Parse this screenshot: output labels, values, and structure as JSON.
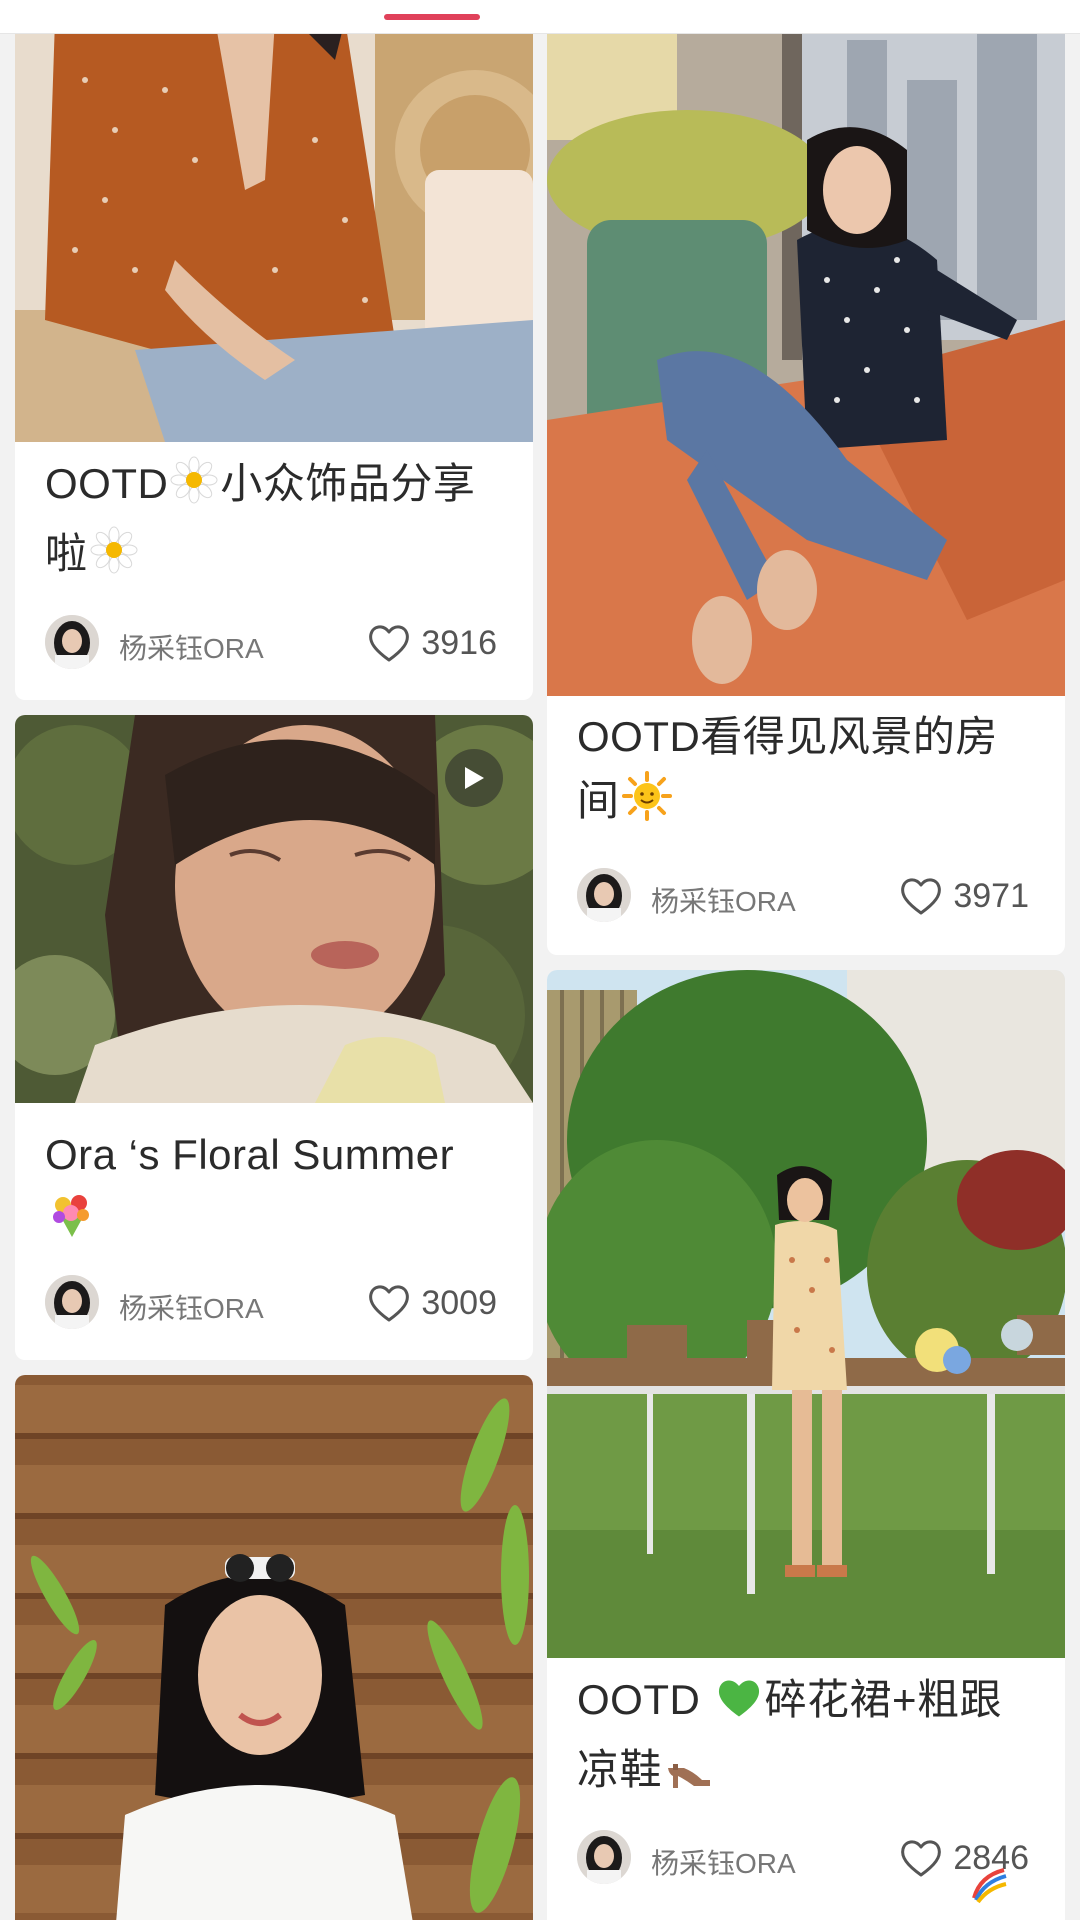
{
  "colors": {
    "accent": "#e0415a",
    "background": "#f2f2f2",
    "card": "#ffffff",
    "title_text": "#2b2b2b",
    "meta_text": "#777777"
  },
  "feed": {
    "author_name": "杨采钰ORA",
    "posts": [
      {
        "title_a": "OOTD",
        "title_b": "小众饰品分享",
        "title_c": "啦",
        "likes": "3916",
        "has_video": false,
        "icon_a": "daisy-icon",
        "icon_b": "daisy-icon"
      },
      {
        "title_a": "OOTD看得见风景的房",
        "title_b": "间",
        "likes": "3971",
        "has_video": false,
        "icon_a": "sun-icon"
      },
      {
        "title_a": "Ora ‘s Floral Summer",
        "likes": "3009",
        "has_video": true,
        "icon_a": "bouquet-icon"
      },
      {
        "title_a": "OOTD ",
        "title_b": "碎花裙+粗跟",
        "title_c": "凉鞋",
        "likes": "2846",
        "has_video": false,
        "icon_a": "green-heart-icon",
        "icon_b": "high-heel-icon"
      }
    ]
  }
}
